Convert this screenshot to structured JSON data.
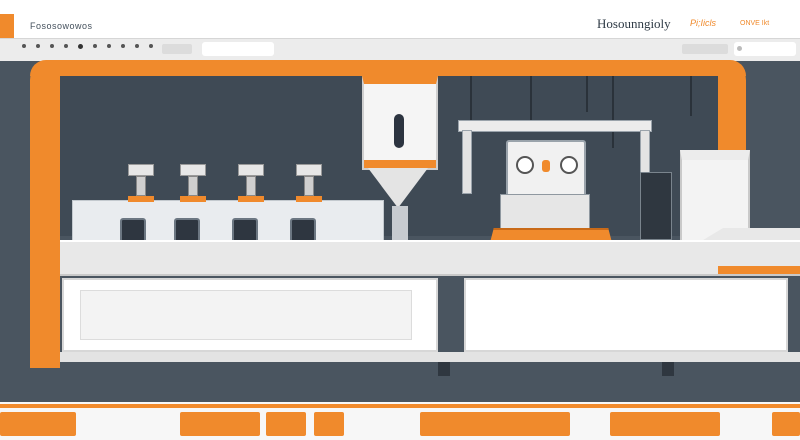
{
  "header": {
    "app_title": "Fososowowos",
    "brand": "Hosounngioly",
    "brand_tag": "Pi;Iicls",
    "brand_small": "ONVE Ikt"
  },
  "colors": {
    "accent": "#f08a2c",
    "frame_dark": "#4a5560",
    "panel_white": "#ffffff"
  },
  "machine": {
    "forming_heads": 4,
    "rollers": 4
  }
}
